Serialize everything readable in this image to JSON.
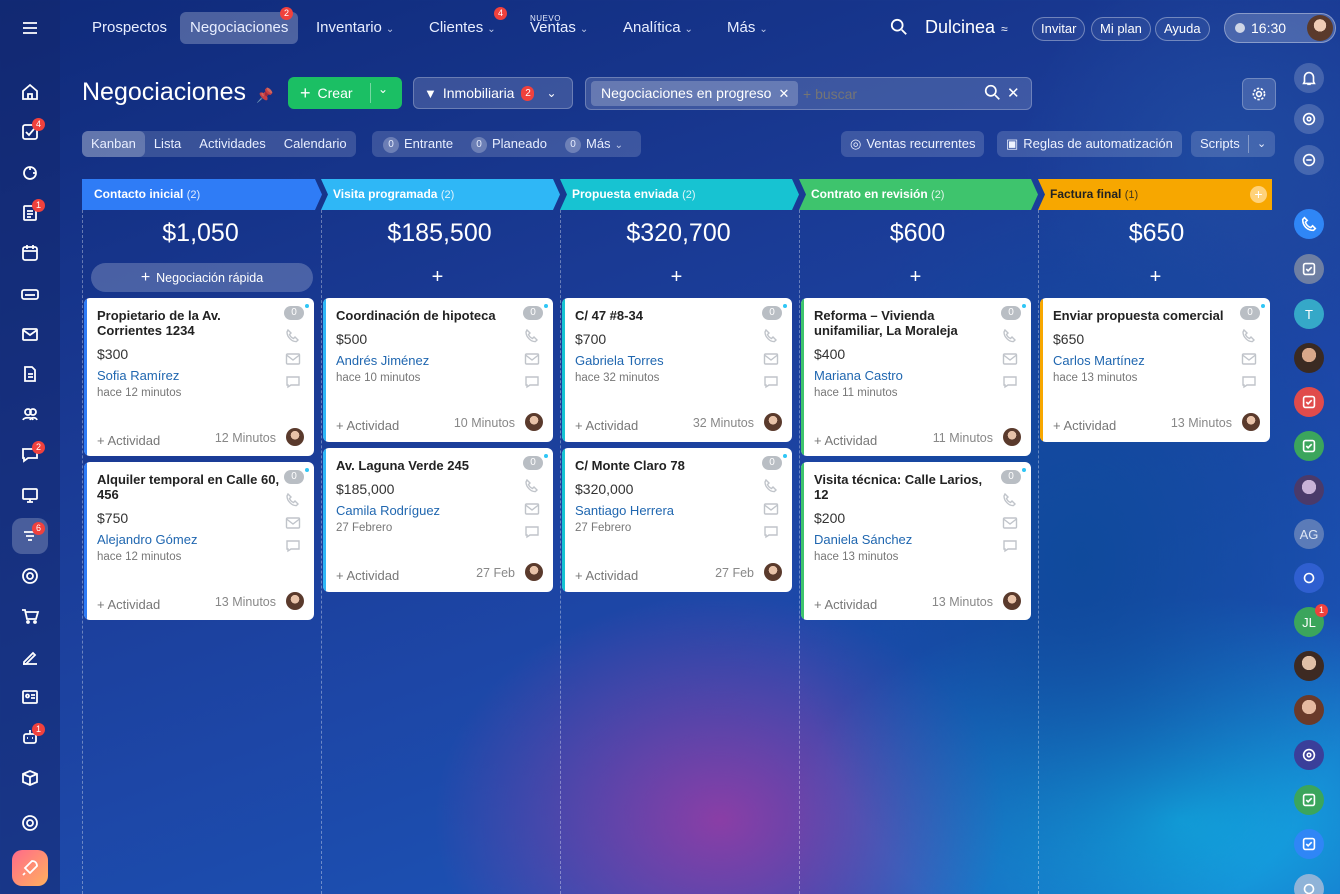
{
  "app": {
    "company": "Dulcinea",
    "time": "16:30"
  },
  "nav": [
    {
      "label": "Prospectos"
    },
    {
      "label": "Negociaciones",
      "badge": "2"
    },
    {
      "label": "Inventario"
    },
    {
      "label": "Clientes",
      "badge": "4"
    },
    {
      "label": "Ventas",
      "tag": "NUEVO"
    },
    {
      "label": "Analítica"
    },
    {
      "label": "Más"
    }
  ],
  "top_actions": {
    "invite": "Invitar",
    "plan": "Mi plan",
    "help": "Ayuda"
  },
  "page": {
    "title": "Negociaciones",
    "create": "Crear",
    "pipeline": "Inmobiliaria",
    "pipeline_badge": "2",
    "filter_tag": "Negociaciones en progreso",
    "search_placeholder": "+ buscar"
  },
  "views": {
    "kanban": "Kanban",
    "list": "Lista",
    "activities": "Actividades",
    "calendar": "Calendario"
  },
  "counters": {
    "incoming": "Entrante",
    "incoming_count": "0",
    "planned": "Planeado",
    "planned_count": "0",
    "more": "Más",
    "more_count": "0"
  },
  "right_buttons": {
    "recurring": "Ventas recurrentes",
    "automation": "Reglas de automatización",
    "scripts": "Scripts"
  },
  "quick_deal": "Negociación rápida",
  "left_badges": {
    "tasks": "4",
    "docs": "1",
    "chat": "2",
    "crm": "6",
    "robot": "1"
  },
  "right_badges": {
    "jl": "1"
  },
  "right_avatars": {
    "t": "T",
    "ag": "AG",
    "jl": "JL"
  },
  "colors": {
    "stage1": "#2f7cf6",
    "stage2": "#2fb7f6",
    "stage3": "#17c3d2",
    "stage4": "#3ec46d",
    "stage5": "#f7a700"
  },
  "columns": [
    {
      "name": "Contacto inicial",
      "count": "(2)",
      "sum": "$1,050",
      "cards": [
        {
          "title": "Propietario de la Av. Corrientes 1234",
          "amount": "$300",
          "contact": "Sofia Ramírez",
          "when": "hace 12 minutos",
          "activity": "+ Actividad",
          "mins": "12 Minutos",
          "count": "0"
        },
        {
          "title": "Alquiler temporal en Calle 60, 456",
          "amount": "$750",
          "contact": "Alejandro Gómez",
          "when": "hace 12 minutos",
          "activity": "+ Actividad",
          "mins": "13 Minutos",
          "count": "0"
        }
      ]
    },
    {
      "name": "Visita programada",
      "count": "(2)",
      "sum": "$185,500",
      "cards": [
        {
          "title": "Coordinación de hipoteca",
          "amount": "$500",
          "contact": "Andrés Jiménez",
          "when": "hace 10 minutos",
          "activity": "+ Actividad",
          "mins": "10 Minutos",
          "count": "0"
        },
        {
          "title": "Av. Laguna Verde 245",
          "amount": "$185,000",
          "contact": "Camila Rodríguez",
          "when": "27 Febrero",
          "activity": "+ Actividad",
          "mins": "27 Feb",
          "count": "0"
        }
      ]
    },
    {
      "name": "Propuesta enviada",
      "count": "(2)",
      "sum": "$320,700",
      "cards": [
        {
          "title": "C/ 47 #8-34",
          "amount": "$700",
          "contact": "Gabriela Torres",
          "when": "hace 32 minutos",
          "activity": "+ Actividad",
          "mins": "32 Minutos",
          "count": "0"
        },
        {
          "title": "C/ Monte Claro 78",
          "amount": "$320,000",
          "contact": "Santiago Herrera",
          "when": "27 Febrero",
          "activity": "+ Actividad",
          "mins": "27 Feb",
          "count": "0"
        }
      ]
    },
    {
      "name": "Contrato en revisión",
      "count": "(2)",
      "sum": "$600",
      "cards": [
        {
          "title": "Reforma – Vivienda unifamiliar, La Moraleja",
          "amount": "$400",
          "contact": "Mariana Castro",
          "when": "hace 11 minutos",
          "activity": "+ Actividad",
          "mins": "11 Minutos",
          "count": "0"
        },
        {
          "title": "Visita técnica: Calle Larios, 12",
          "amount": "$200",
          "contact": "Daniela Sánchez",
          "when": "hace 13 minutos",
          "activity": "+ Actividad",
          "mins": "13 Minutos",
          "count": "0"
        }
      ]
    },
    {
      "name": "Factura final",
      "count": "(1)",
      "sum": "$650",
      "cards": [
        {
          "title": "Enviar propuesta comercial",
          "amount": "$650",
          "contact": "Carlos Martínez",
          "when": "hace 13 minutos",
          "activity": "+ Actividad",
          "mins": "13 Minutos",
          "count": "0"
        }
      ]
    }
  ]
}
